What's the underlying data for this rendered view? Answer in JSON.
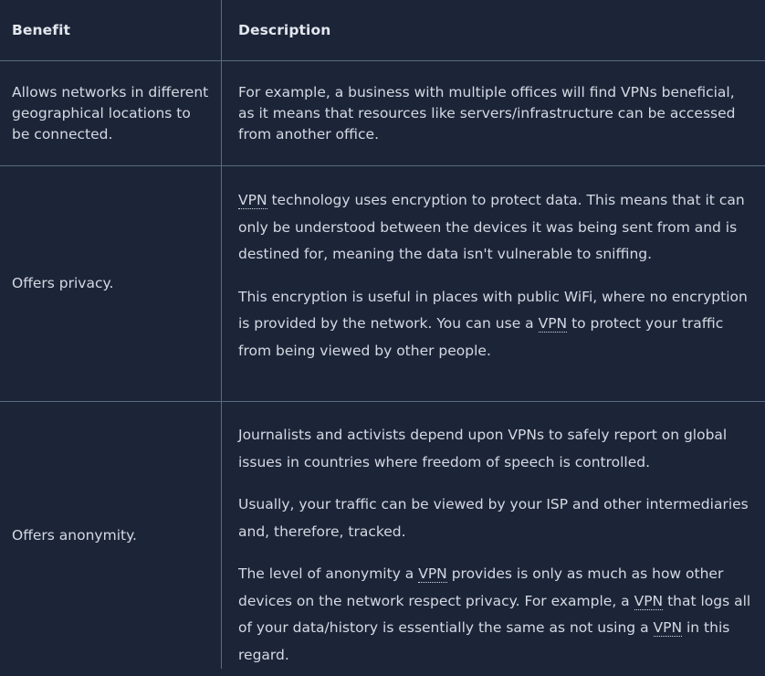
{
  "table": {
    "headers": [
      "Benefit",
      "Description"
    ],
    "rows": [
      {
        "benefit": "Allows networks in different geographical locations to be connected.",
        "description": [
          "For example, a business with multiple offices will find VPNs beneficial, as it means that resources like servers/infrastructure can be accessed from another office."
        ]
      },
      {
        "benefit": "Offers privacy.",
        "description": [
          "VPN technology uses encryption to protect data. This means that it can only be understood between the devices it was being sent from and is destined for, meaning the data isn't vulnerable to sniffing.",
          "This encryption is useful in places with public WiFi, where no encryption is provided by the network. You can use a VPN to protect your traffic from being viewed by other people."
        ]
      },
      {
        "benefit": "Offers anonymity.",
        "description": [
          "Journalists and activists depend upon VPNs to safely report on global issues in countries where freedom of speech is controlled.",
          "Usually, your traffic can be viewed by your ISP and other intermediaries and, therefore, tracked.",
          "The level of anonymity a VPN provides is only as much as how other devices on the network respect privacy. For example, a VPN that logs all of your data/history is essentially the same as not using a VPN in this regard."
        ]
      }
    ]
  },
  "colors": {
    "background": "#1c2538",
    "border": "#5a6a80",
    "text": "#d4d9e2"
  }
}
